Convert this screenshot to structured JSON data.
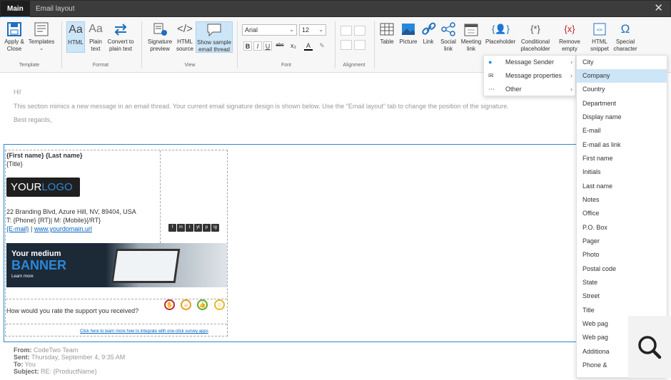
{
  "window": {
    "tabs": [
      "Main",
      "Email layout"
    ],
    "active_tab": "Main"
  },
  "ribbon": {
    "groups": {
      "template": "Template",
      "format": "Format",
      "view": "View",
      "font": "Font",
      "alignment": "Alignment"
    },
    "buttons": {
      "apply_close": [
        "Apply &",
        "Close"
      ],
      "templates": "Templates",
      "html": "HTML",
      "plain_text": [
        "Plain",
        "text"
      ],
      "convert": [
        "Convert to",
        "plain text"
      ],
      "sig_preview": [
        "Signature",
        "preview"
      ],
      "html_source": [
        "HTML",
        "source"
      ],
      "sample_thread": [
        "Show sample",
        "email thread"
      ],
      "table": "Table",
      "picture": "Picture",
      "link": "Link",
      "social_link": [
        "Social",
        "link"
      ],
      "meeting_link": [
        "Meeting",
        "link"
      ],
      "placeholder": "Placeholder",
      "conditional": [
        "Conditional",
        "placeholder"
      ],
      "remove_empty": [
        "Remove",
        "empty"
      ],
      "html_snippet": [
        "HTML",
        "snippet"
      ],
      "special_char": [
        "Special",
        "character"
      ]
    },
    "font_name": "Arial",
    "font_size": "12",
    "format_buttons": [
      "B",
      "I",
      "U",
      "abc",
      "x₂",
      "A",
      "✎"
    ]
  },
  "message": {
    "greeting": "Hi!",
    "body": "This section mimics a new message in an email thread. Your current email signature design is shown below. Use the \"Email layout\" tab to change the position of the signature.",
    "closing": "Best regards,"
  },
  "signature": {
    "name": "{First name} {Last name}",
    "title": "{Title}",
    "logo_main": "YOUR",
    "logo_accent": "LOGO",
    "address": "22 Branding Blvd, Azure Hill, NV, 89404, USA",
    "phones": "T: {Phone} {RT}| M: {Mobile}{/RT}",
    "email": "{E-mail}",
    "separator": " | ",
    "website": "www.yourdomain.url",
    "social_icons": [
      "f",
      "in",
      "t",
      "yt",
      "p",
      "ig"
    ],
    "banner_line1": "Your medium",
    "banner_line2": "BANNER",
    "banner_cta": "Learn more",
    "survey_question": "How would you rate the support you received?",
    "survey_link": "Click here to learn more how to integrate with one-click survey apps",
    "rating_colors": [
      "#c0262d",
      "#e89b1d",
      "#5aa832",
      "#e8b81d"
    ]
  },
  "thread": {
    "from_label": "From:",
    "from_value": "CodeTwo Team",
    "sent_label": "Sent:",
    "sent_value": "Thursday, September 4, 9:35 AM",
    "to_label": "To:",
    "to_value": "You",
    "subject_label": "Subject:",
    "subject_value": "RE: {ProductName}"
  },
  "placeholder_menu": {
    "items": [
      {
        "label": "Message Sender",
        "icon": "person-icon"
      },
      {
        "label": "Message properties",
        "icon": "envelope-icon"
      },
      {
        "label": "Other",
        "icon": "more-icon"
      }
    ]
  },
  "sender_submenu": {
    "items": [
      "City",
      "Company",
      "Country",
      "Department",
      "Display name",
      "E-mail",
      "E-mail as link",
      "First name",
      "Initials",
      "Last name",
      "Notes",
      "Office",
      "P.O. Box",
      "Pager",
      "Photo",
      "Postal code",
      "State",
      "Street",
      "Title",
      "Web pag",
      "Web pag",
      "Additiona",
      "Phone &"
    ],
    "highlighted": "Company"
  },
  "colors": {
    "accent": "#2b88d8",
    "highlight": "#cde6f7",
    "titlebar": "#3c3c3c"
  }
}
